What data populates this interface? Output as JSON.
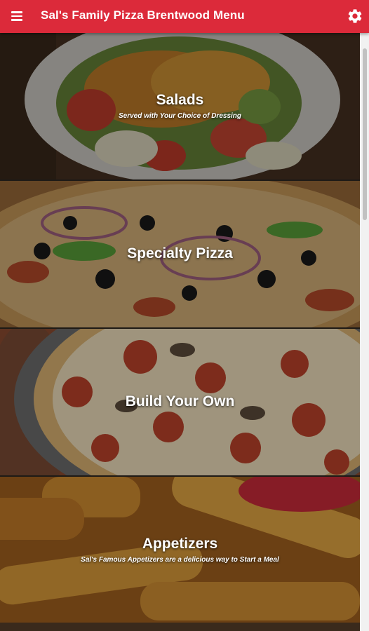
{
  "header": {
    "title": "Sal's Family Pizza Brentwood Menu",
    "menu_icon": "hamburger-menu-icon",
    "settings_icon": "gear-icon"
  },
  "categories": [
    {
      "title": "Salads",
      "subtitle": "Served with Your Choice of Dressing",
      "image": "salad-photo"
    },
    {
      "title": "Specialty Pizza",
      "subtitle": "",
      "image": "specialty-pizza-photo"
    },
    {
      "title": "Build Your Own",
      "subtitle": "",
      "image": "pepperoni-pizza-photo"
    },
    {
      "title": "Appetizers",
      "subtitle": "Sal's Famous Appetizers are a delicious way to Start a Meal",
      "image": "breadsticks-photo"
    }
  ],
  "colors": {
    "app_bar": "#dc2a3a",
    "title_text": "#ffffff"
  }
}
